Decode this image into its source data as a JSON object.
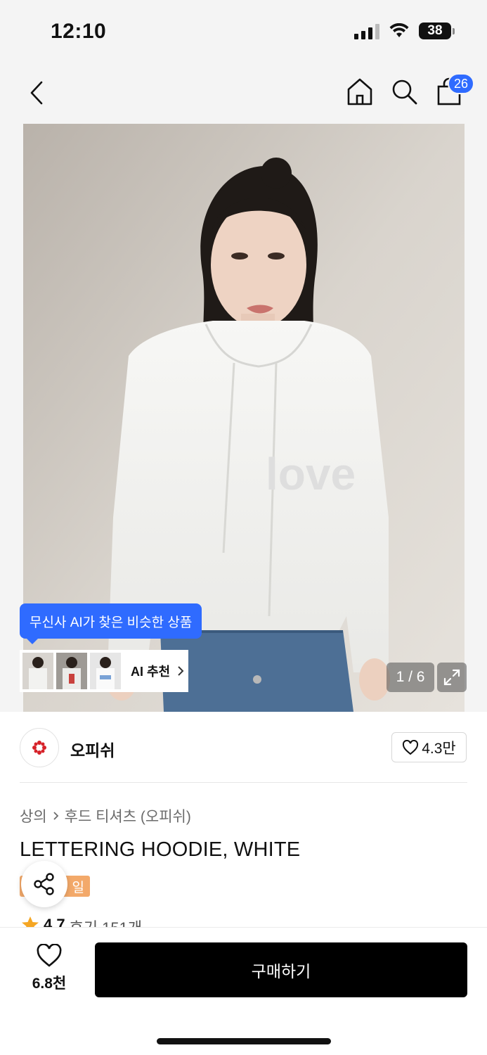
{
  "status_bar": {
    "time": "12:10",
    "battery": "38",
    "battery_level": 0.38
  },
  "header": {
    "cart_count": "26",
    "icons": [
      "back-icon",
      "home-icon",
      "search-icon",
      "shopping-bag-icon"
    ]
  },
  "gallery": {
    "ai_bubble": "무신사 AI가 찾은 비슷한 상품",
    "ai_recommend_label": "AI 추천",
    "counter": "1 / 6"
  },
  "brand": {
    "name": "오피쉬",
    "likes": "4.3만"
  },
  "breadcrumb": {
    "category": "상의",
    "subcategory": "후드 티셔츠 (오피쉬)"
  },
  "product": {
    "title": "LETTERING HOODIE, WHITE",
    "tag": "일"
  },
  "rating": {
    "score": "4.7",
    "reviews": "후기 151개"
  },
  "bottom": {
    "wish_count": "6.8천",
    "buy_label": "구매하기"
  },
  "colors": {
    "accent": "#2f6bff",
    "tag": "#f3a96a",
    "star": "#f5a623",
    "buy": "#000000"
  }
}
